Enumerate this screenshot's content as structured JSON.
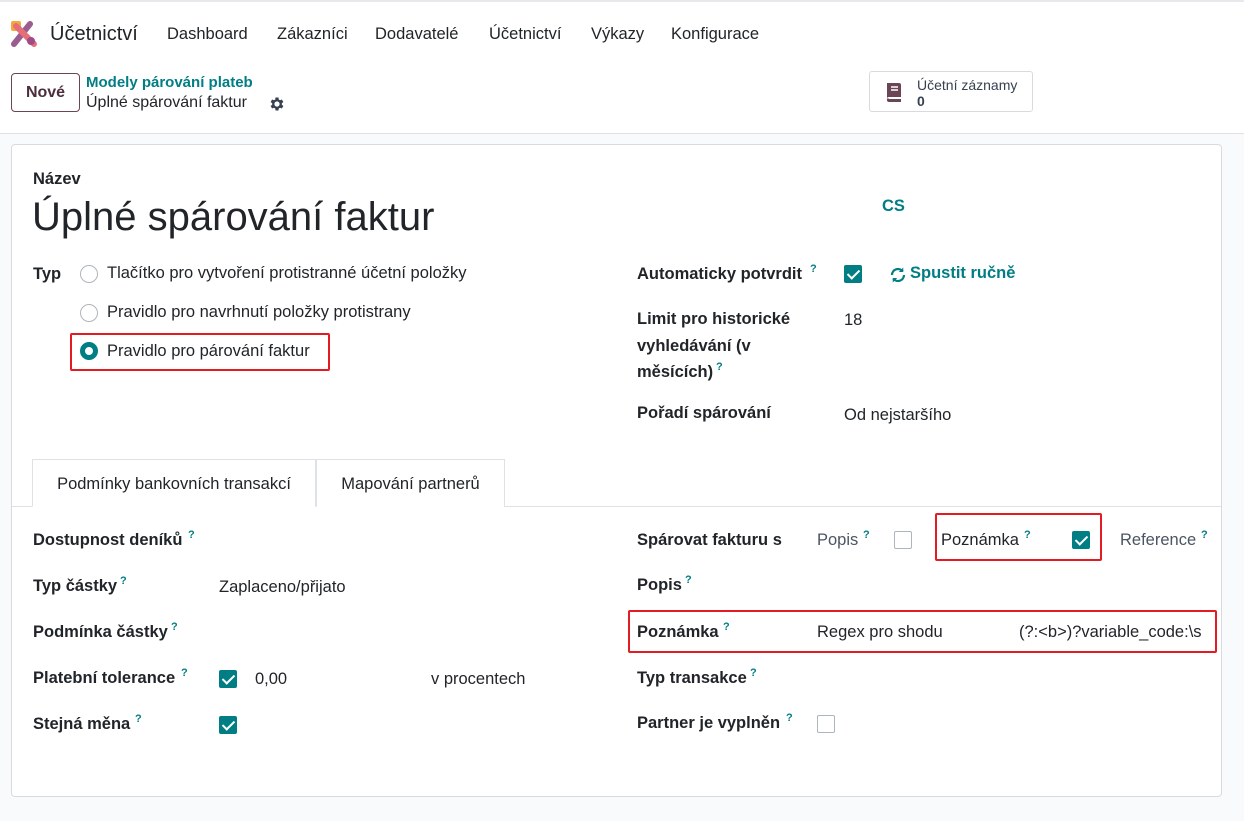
{
  "nav": {
    "brand": "Účetnictví",
    "menu": [
      "Dashboard",
      "Zákazníci",
      "Dodavatelé",
      "Účetnictví",
      "Výkazy",
      "Konfigurace"
    ]
  },
  "control": {
    "new_label": "Nové",
    "breadcrumb_parent": "Modely párování plateb",
    "breadcrumb_current": "Úplné spárování faktur",
    "smart_label": "Účetní záznamy",
    "smart_count": "0"
  },
  "form": {
    "name_label": "Název",
    "name_value": "Úplné spárování faktur",
    "lang": "CS",
    "type_label": "Typ",
    "type_options": [
      {
        "label": "Tlačítko pro vytvoření protistranné účetní položky",
        "selected": false
      },
      {
        "label": "Pravidlo pro navrhnutí položky protistrany",
        "selected": false
      },
      {
        "label": "Pravidlo pro párování faktur",
        "selected": true
      }
    ],
    "auto_confirm_label": "Automaticky potvrdit",
    "auto_confirm_checked": true,
    "run_manual": "Spustit ručně",
    "history_limit_label_1": "Limit pro historické",
    "history_limit_label_2": "vyhledávání (v",
    "history_limit_label_3": "měsících)",
    "history_limit_value": "18",
    "order_label": "Pořadí spárování",
    "order_value": "Od nejstaršího",
    "tip": "?"
  },
  "tabs": [
    "Podmínky bankovních transakcí",
    "Mapování partnerů"
  ],
  "conditions": {
    "journal_avail": "Dostupnost deníků",
    "amount_type": "Typ částky",
    "amount_type_value": "Zaplaceno/přijato",
    "amount_cond": "Podmínka částky",
    "tolerance": "Platební tolerance",
    "tolerance_value": "0,00",
    "tolerance_unit": "v procentech",
    "same_currency": "Stejná měna",
    "match_invoice": "Spárovat fakturu s",
    "match_desc": "Popis",
    "match_note": "Poznámka",
    "match_ref": "Reference",
    "desc_label": "Popis",
    "note_label": "Poznámka",
    "note_mode": "Regex pro shodu",
    "note_regex": "(?:<b>)?variable_code:\\s",
    "trans_type": "Typ transakce",
    "partner_set": "Partner je vyplněn"
  }
}
